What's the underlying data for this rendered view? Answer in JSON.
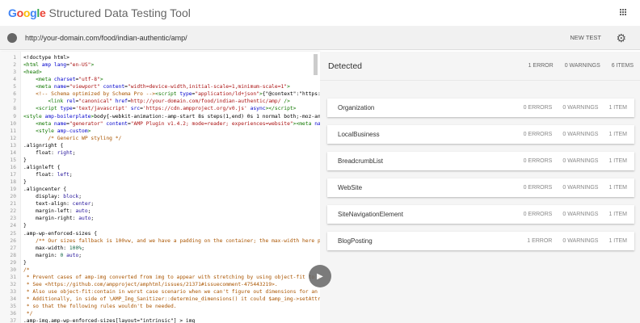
{
  "header": {
    "logo_letters": [
      "G",
      "o",
      "o",
      "g",
      "l",
      "e"
    ],
    "title": "Structured Data Testing Tool"
  },
  "urlbar": {
    "url": "http://your-domain.com/food/indian-authentic/amp/",
    "new_test": "NEW TEST"
  },
  "code": {
    "lines": [
      [
        [
          "p",
          "<!doctype html>"
        ]
      ],
      [
        [
          "t",
          "<html "
        ],
        [
          "a",
          "amp"
        ],
        [
          "a",
          " lang"
        ],
        [
          "p",
          "="
        ],
        [
          "s",
          "\"en-US\""
        ],
        [
          "t",
          ">"
        ]
      ],
      [
        [
          "t",
          "<head>"
        ]
      ],
      [
        [
          "p",
          "    "
        ],
        [
          "t",
          "<meta "
        ],
        [
          "a",
          "charset"
        ],
        [
          "p",
          "="
        ],
        [
          "s",
          "\"utf-8\""
        ],
        [
          "t",
          ">"
        ]
      ],
      [
        [
          "p",
          "    "
        ],
        [
          "t",
          "<meta "
        ],
        [
          "a",
          "name"
        ],
        [
          "p",
          "="
        ],
        [
          "s",
          "\"viewport\""
        ],
        [
          "a",
          " content"
        ],
        [
          "p",
          "="
        ],
        [
          "s",
          "\"width=device-width,initial-scale=1,minimum-scale=1\""
        ],
        [
          "t",
          ">"
        ]
      ],
      [
        [
          "p",
          "    "
        ],
        [
          "c",
          "<!-- Schema optimized by Schema Pro -->"
        ],
        [
          "t",
          "<script "
        ],
        [
          "a",
          "type"
        ],
        [
          "p",
          "="
        ],
        [
          "s",
          "\"application/ld+json\""
        ],
        [
          "t",
          ">"
        ],
        [
          "p",
          "{\"@context\":\"https:\\/\\/"
        ]
      ],
      [
        [
          "p",
          "        "
        ],
        [
          "t",
          "<link "
        ],
        [
          "a",
          "rel"
        ],
        [
          "p",
          "="
        ],
        [
          "s",
          "\"canonical\""
        ],
        [
          "a",
          " href"
        ],
        [
          "p",
          "="
        ],
        [
          "s",
          "http://your-domain.com/food/indian-authentic/amp/"
        ],
        [
          "t",
          " />"
        ]
      ],
      [
        [
          "p",
          "    "
        ],
        [
          "t",
          "<script "
        ],
        [
          "a",
          "type"
        ],
        [
          "p",
          "="
        ],
        [
          "s",
          "'text/javascript'"
        ],
        [
          "a",
          " src"
        ],
        [
          "p",
          "="
        ],
        [
          "s",
          "'https://cdn.ampproject.org/v0.js'"
        ],
        [
          "a",
          " async"
        ],
        [
          "t",
          "></script>"
        ]
      ],
      [
        [
          "t",
          "<style "
        ],
        [
          "a",
          "amp-boilerplate"
        ],
        [
          "t",
          ">"
        ],
        [
          "p",
          "body{-webkit-animation:-amp-start 8s steps(1,end) 0s 1 normal both;-moz-animati"
        ]
      ],
      [
        [
          "p",
          "    "
        ],
        [
          "t",
          "<meta "
        ],
        [
          "a",
          "name"
        ],
        [
          "p",
          "="
        ],
        [
          "s",
          "\"generator\""
        ],
        [
          "a",
          " content"
        ],
        [
          "p",
          "="
        ],
        [
          "s",
          "\"AMP Plugin v1.4.2; mode=reader; experiences=website\""
        ],
        [
          "t",
          "><meta "
        ],
        [
          "a",
          "name"
        ],
        [
          "p",
          "="
        ]
      ],
      [
        [
          "p",
          "    "
        ],
        [
          "t",
          "<style "
        ],
        [
          "a",
          "amp-custom"
        ],
        [
          "t",
          ">"
        ]
      ],
      [
        [
          "p",
          "        "
        ],
        [
          "c",
          "/* Generic WP styling */"
        ]
      ],
      [
        [
          "p",
          ".alignright {"
        ]
      ],
      [
        [
          "p",
          "    float: "
        ],
        [
          "k",
          "right"
        ],
        [
          "p",
          ";"
        ]
      ],
      [
        [
          "p",
          "}"
        ]
      ],
      [
        [
          "p",
          ".alignleft {"
        ]
      ],
      [
        [
          "p",
          "    float: "
        ],
        [
          "k",
          "left"
        ],
        [
          "p",
          ";"
        ]
      ],
      [
        [
          "p",
          "}"
        ]
      ],
      [
        [
          "p",
          ".aligncenter {"
        ]
      ],
      [
        [
          "p",
          "    display: "
        ],
        [
          "k",
          "block"
        ],
        [
          "p",
          ";"
        ]
      ],
      [
        [
          "p",
          "    text-align: "
        ],
        [
          "k",
          "center"
        ],
        [
          "p",
          ";"
        ]
      ],
      [
        [
          "p",
          "    margin-left: "
        ],
        [
          "k",
          "auto"
        ],
        [
          "p",
          ";"
        ]
      ],
      [
        [
          "p",
          "    margin-right: "
        ],
        [
          "k",
          "auto"
        ],
        [
          "p",
          ";"
        ]
      ],
      [
        [
          "p",
          "}"
        ]
      ],
      [
        [
          "p",
          ".amp-wp-enforced-sizes {"
        ]
      ],
      [
        [
          "p",
          "    "
        ],
        [
          "c",
          "/** Our sizes fallback is 100vw, and we have a padding on the container; the max-width here preve"
        ]
      ],
      [
        [
          "p",
          "    max-width: "
        ],
        [
          "n",
          "100%"
        ],
        [
          "p",
          ";"
        ]
      ],
      [
        [
          "p",
          "    margin: "
        ],
        [
          "n",
          "0"
        ],
        [
          "k",
          " auto"
        ],
        [
          "p",
          ";"
        ]
      ],
      [
        [
          "p",
          "}"
        ]
      ],
      [
        [
          "c",
          "/*"
        ]
      ],
      [
        [
          "c",
          " * Prevent cases of amp-img converted from img to appear with stretching by using object-fit to s"
        ]
      ],
      [
        [
          "c",
          " * See <https://github.com/ampproject/amphtml/issues/21371#issuecomment-475443219>."
        ]
      ],
      [
        [
          "c",
          " * Also use object-fit:contain in worst case scenario when we can't figure out dimensions for an ima"
        ]
      ],
      [
        [
          "c",
          " * Additionally, in side of \\AMP_Img_Sanitizer::determine_dimensions() it could $amp_img->setAttribu"
        ]
      ],
      [
        [
          "c",
          " * so that the following rules wouldn't be needed."
        ]
      ],
      [
        [
          "c",
          " */"
        ]
      ],
      [
        [
          "p",
          ".amp-img.amp-wp-enforced-sizes[layout=\"intrinsic\"] > img"
        ]
      ]
    ]
  },
  "detected": {
    "label": "Detected",
    "errors": "1 ERROR",
    "warnings": "0 WARNINGS",
    "items": "6 ITEMS",
    "cards": [
      {
        "name": "Organization",
        "errors": "0 ERRORS",
        "warnings": "0 WARNINGS",
        "items": "1 ITEM"
      },
      {
        "name": "LocalBusiness",
        "errors": "0 ERRORS",
        "warnings": "0 WARNINGS",
        "items": "1 ITEM"
      },
      {
        "name": "BreadcrumbList",
        "errors": "0 ERRORS",
        "warnings": "0 WARNINGS",
        "items": "1 ITEM"
      },
      {
        "name": "WebSite",
        "errors": "0 ERRORS",
        "warnings": "0 WARNINGS",
        "items": "1 ITEM"
      },
      {
        "name": "SiteNavigationElement",
        "errors": "0 ERRORS",
        "warnings": "0 WARNINGS",
        "items": "1 ITEM"
      },
      {
        "name": "BlogPosting",
        "errors": "1 ERROR",
        "warnings": "0 WARNINGS",
        "items": "1 ITEM"
      }
    ]
  }
}
